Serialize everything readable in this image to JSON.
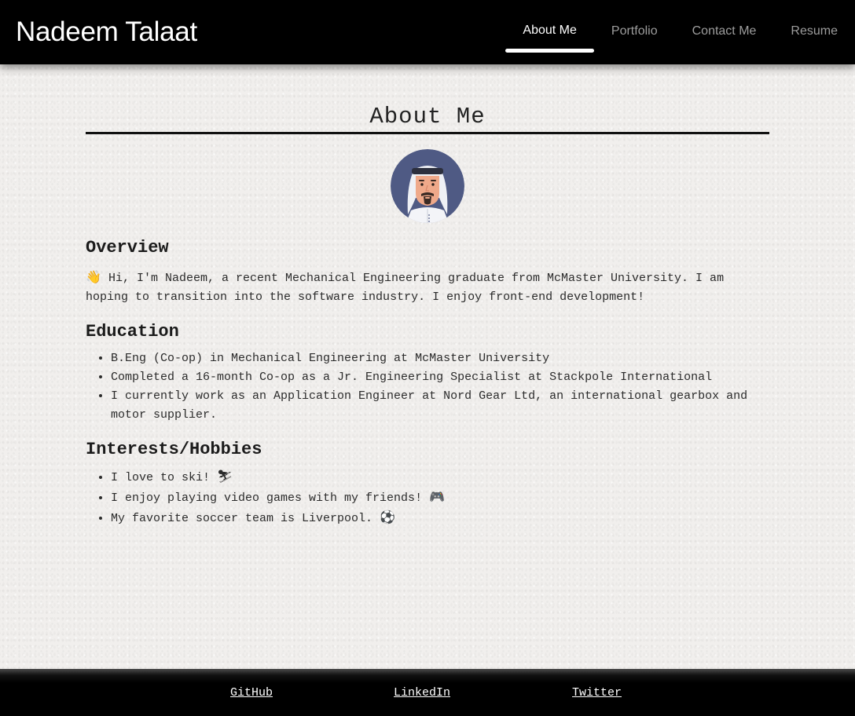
{
  "header": {
    "brand": "Nadeem Talaat",
    "nav": [
      {
        "label": "About Me",
        "active": true
      },
      {
        "label": "Portfolio",
        "active": false
      },
      {
        "label": "Contact Me",
        "active": false
      },
      {
        "label": "Resume",
        "active": false
      }
    ]
  },
  "main": {
    "title": "About Me",
    "avatar_icon": "avatar-keffiyeh-man",
    "overview": {
      "heading": "Overview",
      "emoji": "👋",
      "text": "Hi, I'm Nadeem, a recent Mechanical Engineering graduate from McMaster University. I am hoping to transition into the software industry. I enjoy front-end development!"
    },
    "education": {
      "heading": "Education",
      "items": [
        "B.Eng (Co-op) in Mechanical Engineering at McMaster University",
        "Completed a 16-month Co-op as a Jr. Engineering Specialist at Stackpole International",
        "I currently work as an Application Engineer at Nord Gear Ltd, an international gearbox and motor supplier."
      ]
    },
    "interests": {
      "heading": "Interests/Hobbies",
      "items": [
        {
          "text": "I love to ski!",
          "emoji": "⛷"
        },
        {
          "text": "I enjoy playing video games with my friends!",
          "emoji": "🎮"
        },
        {
          "text": "My favorite soccer team is Liverpool.",
          "emoji": "⚽"
        }
      ]
    }
  },
  "footer": {
    "links": [
      "GitHub",
      "LinkedIn",
      "Twitter"
    ]
  },
  "colors": {
    "header_bg": "#000000",
    "nav_active": "#ffffff",
    "nav_inactive": "#9d9d9d",
    "avatar_ring": "#4f5a84"
  }
}
